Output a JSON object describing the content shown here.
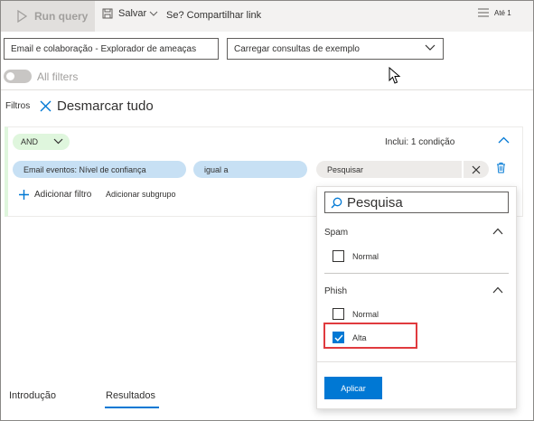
{
  "toolbar": {
    "run_query": "Run query",
    "save": "Salvar",
    "share": "Se? Compartilhar link",
    "ate": "Até 1"
  },
  "selects": {
    "explorer": "Email e colaboração - Explorador de ameaças",
    "examples": "Carregar consultas de exemplo"
  },
  "toggle": {
    "label": "All filters",
    "on": false
  },
  "filters": {
    "label": "Filtros",
    "clear_all": "Desmarcar tudo",
    "group": {
      "operator": "AND",
      "includes": "Inclui: 1 condição",
      "condition": {
        "field": "Email eventos: Nível de confiança",
        "operator": "igual a",
        "value_placeholder": "Pesquisar"
      },
      "add_filter": "Adicionar filtro",
      "add_subgroup": "Adicionar subgrupo"
    }
  },
  "dropdown": {
    "search_text": "Pesquisa",
    "groups": [
      {
        "header": "Spam",
        "options": [
          {
            "label": "Normal",
            "checked": false
          }
        ]
      },
      {
        "header": "Phish",
        "options": [
          {
            "label": "Normal",
            "checked": false
          },
          {
            "label": "Alta",
            "checked": true
          }
        ]
      }
    ],
    "apply": "Aplicar"
  },
  "tabs": [
    {
      "label": "Introdução",
      "active": false
    },
    {
      "label": "Resultados",
      "active": true
    }
  ],
  "colors": {
    "accent": "#0078d4",
    "highlight": "#e03a3e",
    "pill": "#c7e0f4",
    "and_pill": "#dff6dd"
  }
}
